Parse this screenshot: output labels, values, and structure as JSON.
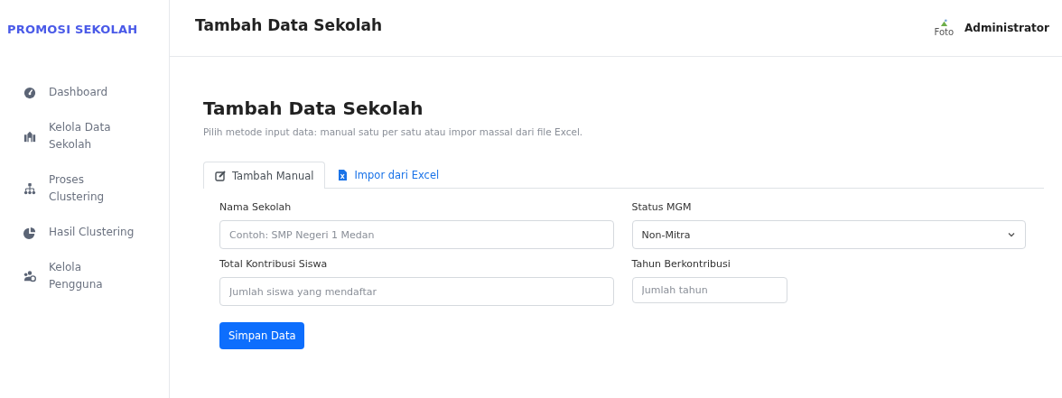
{
  "sidebar": {
    "brand": "PROMOSI SEKOLAH",
    "items": [
      {
        "label": "Dashboard"
      },
      {
        "label": "Kelola Data Sekolah"
      },
      {
        "label": "Proses Clustering"
      },
      {
        "label": "Hasil Clustering"
      },
      {
        "label": "Kelola Pengguna"
      }
    ]
  },
  "header": {
    "title": "Tambah Data Sekolah",
    "avatar_alt": "Foto",
    "user": "Administrator"
  },
  "page": {
    "title": "Tambah Data Sekolah",
    "subtitle": "Pilih metode input data: manual satu per satu atau impor massal dari file Excel."
  },
  "tabs": [
    {
      "label": "Tambah Manual",
      "selected": true
    },
    {
      "label": "Impor dari Excel",
      "selected": false
    }
  ],
  "form": {
    "fields": [
      {
        "kind": "text",
        "label": "Nama Sekolah",
        "placeholder": "Contoh: SMP Negeri 1 Medan"
      },
      {
        "kind": "select",
        "label": "Status MGM",
        "value": "Non-Mitra"
      },
      {
        "kind": "text",
        "label": "Total Kontribusi Siswa",
        "placeholder": "Jumlah siswa yang mendaftar"
      },
      {
        "kind": "short",
        "label": "Tahun Berkontribusi",
        "placeholder": "Jumlah tahun"
      }
    ],
    "submit": "Simpan Data"
  }
}
